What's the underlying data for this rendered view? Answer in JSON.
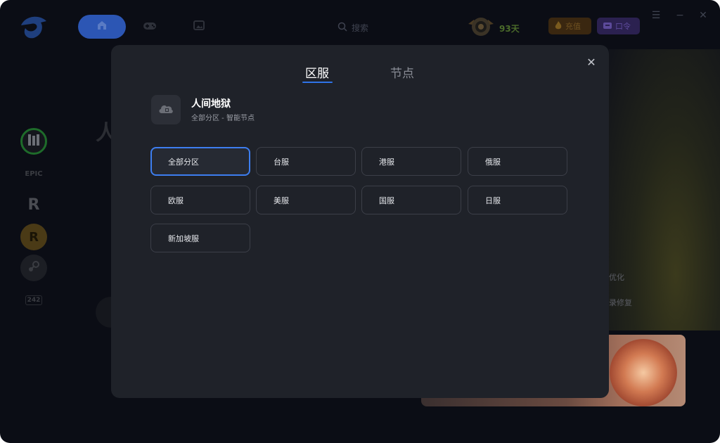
{
  "topbar": {
    "search_placeholder": "搜索",
    "rank_days": "93天",
    "recharge_label": "充值",
    "code_label": "口令"
  },
  "sidebar": {
    "items": [
      {
        "name": "hero-game",
        "label": ""
      },
      {
        "name": "epic",
        "label": "EPIC"
      },
      {
        "name": "riot",
        "label": "R"
      },
      {
        "name": "rockstar",
        "label": "R"
      },
      {
        "name": "steam",
        "label": ""
      },
      {
        "name": "more",
        "label": "242"
      }
    ]
  },
  "background": {
    "big_char": "人",
    "side_text_1": "优化",
    "side_text_2": "录修复"
  },
  "modal": {
    "tabs": [
      {
        "label": "区服",
        "active": true
      },
      {
        "label": "节点",
        "active": false
      }
    ],
    "game_title": "人间地狱",
    "game_subtitle": "全部分区 - 智能节点",
    "regions": [
      {
        "label": "全部分区",
        "selected": true
      },
      {
        "label": "台服",
        "selected": false
      },
      {
        "label": "港服",
        "selected": false
      },
      {
        "label": "俄服",
        "selected": false
      },
      {
        "label": "欧服",
        "selected": false
      },
      {
        "label": "美服",
        "selected": false
      },
      {
        "label": "国服",
        "selected": false
      },
      {
        "label": "日服",
        "selected": false
      },
      {
        "label": "新加坡服",
        "selected": false
      }
    ]
  },
  "colors": {
    "accent": "#2f73e8",
    "modal_bg": "#1f2229",
    "selected_border": "#3d7ef0"
  },
  "icons": {
    "logo": "app-logo-icon",
    "home": "home-icon",
    "gamepad": "gamepad-icon",
    "gallery": "gallery-icon",
    "search": "search-icon",
    "close": "close-icon",
    "game_cloud": "cloud-icon"
  }
}
